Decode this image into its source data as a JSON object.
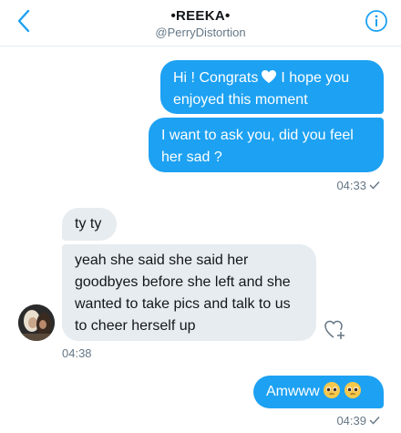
{
  "header": {
    "title": "•REEKA•",
    "handle": "@PerryDistortion"
  },
  "icons": {
    "back": "chevron-left-icon",
    "info": "info-icon",
    "heart_inline": "white-heart-icon",
    "react": "heart-plus-icon",
    "emoji": "pleading-face-icon",
    "read_receipt": "checkmark-icon"
  },
  "colors": {
    "accent": "#1da1f2",
    "incoming_bubble": "#e6ecf0",
    "muted_text": "#657786"
  },
  "messages": [
    {
      "direction": "outgoing",
      "line1_pre": "Hi ! Congrats",
      "line1_post": "I hope you",
      "line2": "enjoyed this moment"
    },
    {
      "direction": "outgoing",
      "text": "I want to ask you, did you feel her sad ?",
      "time": "04:33"
    },
    {
      "direction": "incoming",
      "text": "ty ty"
    },
    {
      "direction": "incoming",
      "text": "yeah she said she said her goodbyes before she left and she wanted to take pics and talk to us to cheer herself up",
      "time": "04:38"
    },
    {
      "direction": "outgoing",
      "text": "Amwww",
      "time": "04:39"
    }
  ]
}
